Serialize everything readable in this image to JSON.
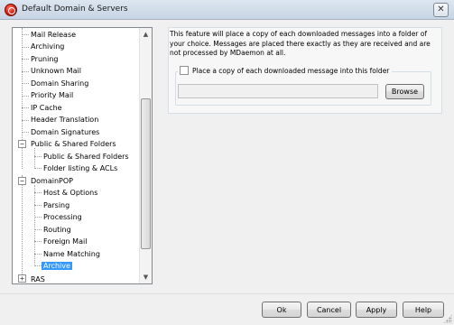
{
  "window": {
    "title": "Default Domain & Servers",
    "close_glyph": "✕"
  },
  "tree": {
    "items": [
      {
        "label": "Mail Release"
      },
      {
        "label": "Archiving"
      },
      {
        "label": "Pruning"
      },
      {
        "label": "Unknown Mail"
      },
      {
        "label": "Domain Sharing"
      },
      {
        "label": "Priority Mail"
      },
      {
        "label": "IP Cache"
      },
      {
        "label": "Header Translation"
      },
      {
        "label": "Domain Signatures"
      },
      {
        "label": "Public & Shared Folders"
      },
      {
        "label": "Public & Shared Folders"
      },
      {
        "label": "Folder listing & ACLs"
      },
      {
        "label": "DomainPOP"
      },
      {
        "label": "Host & Options"
      },
      {
        "label": "Parsing"
      },
      {
        "label": "Processing"
      },
      {
        "label": "Routing"
      },
      {
        "label": "Foreign Mail"
      },
      {
        "label": "Name Matching"
      },
      {
        "label": "Archive"
      },
      {
        "label": "RAS"
      }
    ],
    "expanded_glyph": "−",
    "collapsed_glyph": "+"
  },
  "content": {
    "description": "This feature will place a copy of each downloaded messages into a folder of your choice.  Messages are placed there exactly as they are received and are not processed by MDaemon at all.",
    "checkbox_label": "Place a copy of each downloaded message into this folder",
    "checkbox_checked": false,
    "path_value": "",
    "browse_label": "Browse"
  },
  "buttons": {
    "ok": "Ok",
    "cancel": "Cancel",
    "apply": "Apply",
    "help": "Help"
  },
  "colors": {
    "selection": "#3399ff",
    "app_icon": "#d51c10"
  }
}
